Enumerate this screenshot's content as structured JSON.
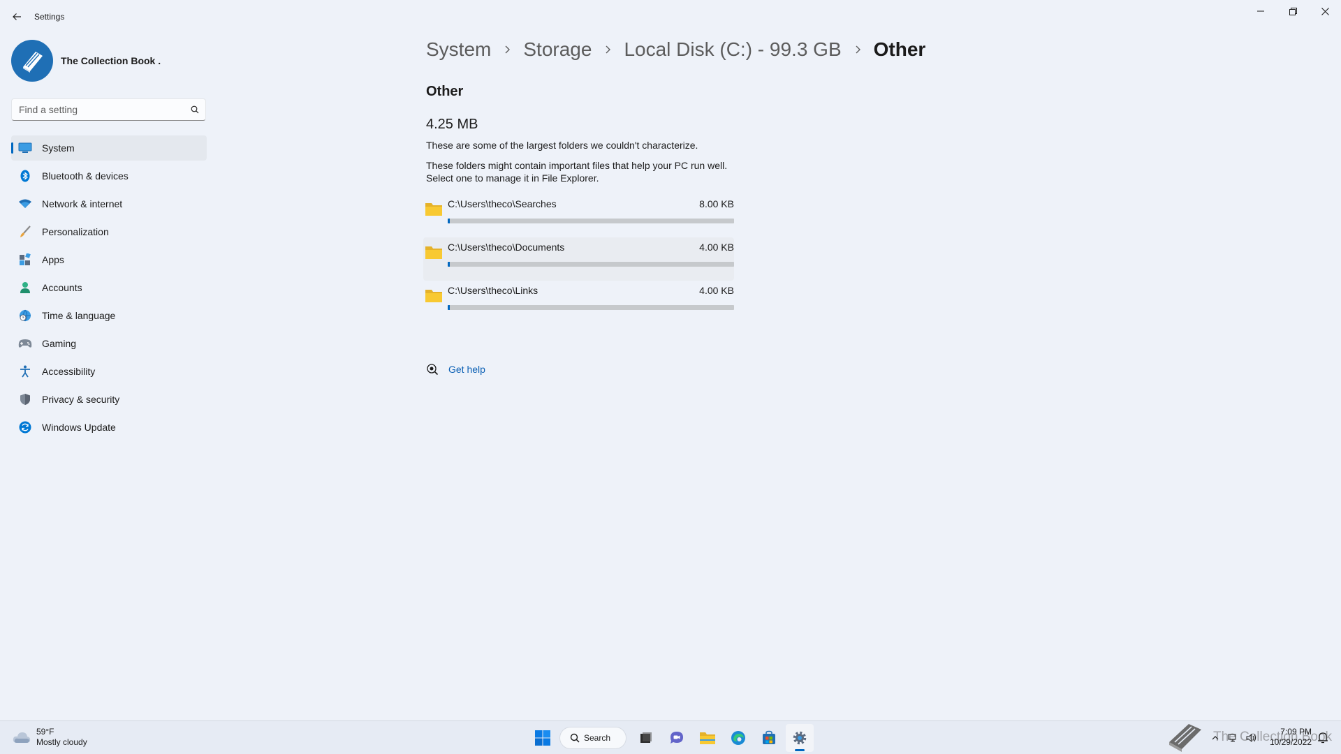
{
  "window": {
    "title": "Settings"
  },
  "profile": {
    "name": "The Collection Book ."
  },
  "search": {
    "placeholder": "Find a setting"
  },
  "sidebar": {
    "items": [
      {
        "label": "System",
        "icon": "monitor-icon",
        "active": true
      },
      {
        "label": "Bluetooth & devices",
        "icon": "bluetooth-icon"
      },
      {
        "label": "Network & internet",
        "icon": "wifi-icon"
      },
      {
        "label": "Personalization",
        "icon": "brush-icon"
      },
      {
        "label": "Apps",
        "icon": "apps-icon"
      },
      {
        "label": "Accounts",
        "icon": "person-icon"
      },
      {
        "label": "Time & language",
        "icon": "globe-clock-icon"
      },
      {
        "label": "Gaming",
        "icon": "gamepad-icon"
      },
      {
        "label": "Accessibility",
        "icon": "accessibility-icon"
      },
      {
        "label": "Privacy & security",
        "icon": "shield-icon"
      },
      {
        "label": "Windows Update",
        "icon": "update-icon"
      }
    ]
  },
  "breadcrumb": {
    "items": [
      "System",
      "Storage",
      "Local Disk (C:) - 99.3 GB"
    ],
    "current": "Other"
  },
  "main": {
    "section_title": "Other",
    "total_size": "4.25 MB",
    "description1": "These are some of the largest folders we couldn't characterize.",
    "description2_line1": "These folders might contain important files that help your PC run well.",
    "description2_line2": "Select one to manage it in File Explorer.",
    "folders": [
      {
        "path": "C:\\Users\\theco\\Searches",
        "size": "8.00 KB",
        "fill": 0.008
      },
      {
        "path": "C:\\Users\\theco\\Documents",
        "size": "4.00 KB",
        "fill": 0.008
      },
      {
        "path": "C:\\Users\\theco\\Links",
        "size": "4.00 KB",
        "fill": 0.008
      }
    ],
    "help_label": "Get help"
  },
  "taskbar": {
    "weather_temp": "59°F",
    "weather_desc": "Mostly cloudy",
    "search_label": "Search",
    "watermark": "The Collection Book",
    "time": "7:09 PM",
    "date": "10/29/2022"
  },
  "colors": {
    "accent": "#0067c0",
    "background": "#eef2f9",
    "link": "#0a5fb4",
    "folder": "#f8c932"
  }
}
